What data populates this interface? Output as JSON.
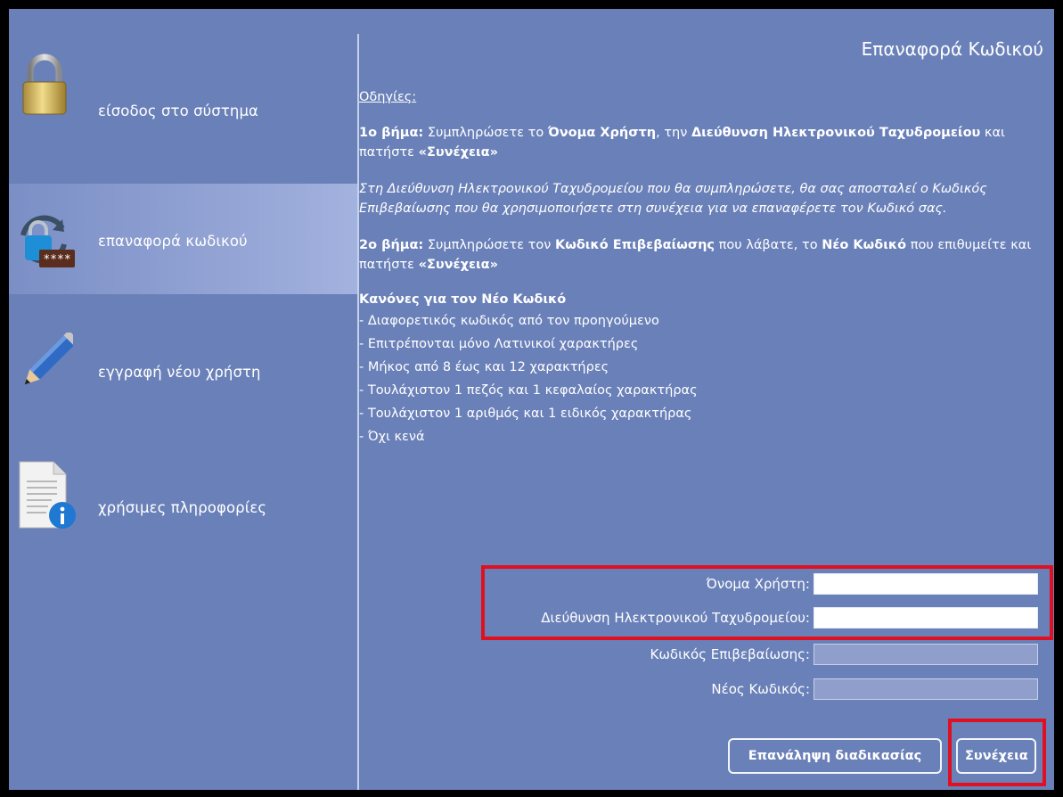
{
  "page_title": "Επαναφορά Κωδικού",
  "sidebar": {
    "items": [
      {
        "label": "είσοδος στο σύστημα",
        "icon": "padlock-icon",
        "active": false
      },
      {
        "label": "επαναφορά κωδικού",
        "icon": "password-reset-icon",
        "active": true
      },
      {
        "label": "εγγραφή νέου χρήστη",
        "icon": "pencil-icon",
        "active": false
      },
      {
        "label": "χρήσιμες πληροφορίες",
        "icon": "info-document-icon",
        "active": false
      }
    ]
  },
  "instructions": {
    "heading": "Οδηγίες:",
    "step1": {
      "label": "1ο βήμα:",
      "t1": " Συμπληρώσετε το ",
      "b1": "Όνομα Χρήστη",
      "t2": ", την ",
      "b2": "Διεύθυνση Ηλεκτρονικού Ταχυδρομείου",
      "t3": " και πατήστε ",
      "b3": "«Συνέχεια»"
    },
    "note": "Στη Διεύθυνση Ηλεκτρονικού Ταχυδρομείου που θα συμπληρώσετε, θα σας αποσταλεί ο Κωδικός Επιβεβαίωσης που θα χρησιμοποιήσετε στη συνέχεια για να επαναφέρετε τον Κωδικό σας.",
    "step2": {
      "label": "2ο βήμα:",
      "t1": " Συμπληρώσετε τον ",
      "b1": "Κωδικό Επιβεβαίωσης",
      "t2": " που λάβατε, το ",
      "b2": "Νέο Κωδικό",
      "t3": " που επιθυμείτε και πατήστε ",
      "b3": "«Συνέχεια»"
    },
    "rules_title": "Κανόνες για τον Νέο Κωδικό",
    "rules": [
      "- Διαφορετικός κωδικός από τον προηγούμενο",
      "- Επιτρέπονται μόνο Λατινικοί χαρακτήρες",
      "- Μήκος από 8 έως και 12 χαρακτήρες",
      "- Τουλάχιστον 1 πεζός και 1 κεφαλαίος χαρακτήρας",
      "- Τουλάχιστον 1 αριθμός και 1 ειδικός χαρακτήρας",
      "- Όχι κενά"
    ]
  },
  "form": {
    "username_label": "Όνομα Χρήστη:",
    "username_value": "",
    "email_label": "Διεύθυνση Ηλεκτρονικού Ταχυδρομείου:",
    "email_value": "",
    "confirm_code_label": "Κωδικός Επιβεβαίωσης:",
    "confirm_code_value": "",
    "new_password_label": "Νέος Κωδικός:",
    "new_password_value": ""
  },
  "buttons": {
    "restart": "Επανάληψη διαδικασίας",
    "continue": "Συνέχεια"
  },
  "colors": {
    "panel_bg": "#6a80b8",
    "highlight": "#e01020"
  }
}
